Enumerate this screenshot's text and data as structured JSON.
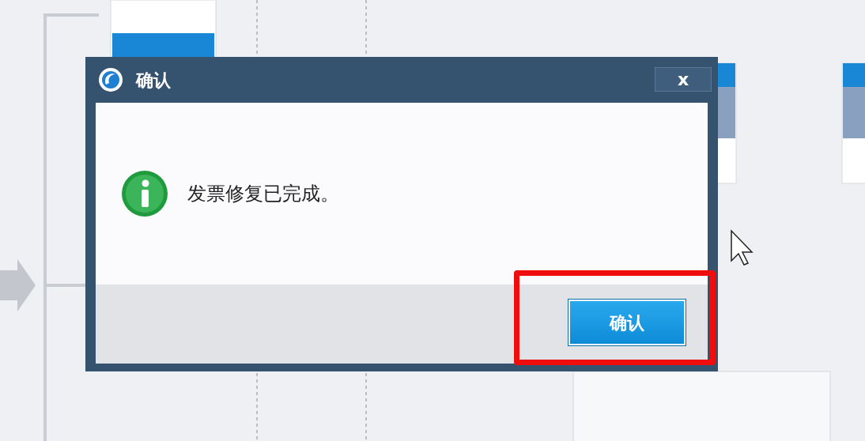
{
  "dialog": {
    "title": "确认",
    "close": "x",
    "message": "发票修复已完成。",
    "button": "确认",
    "button_highlighted": true
  }
}
